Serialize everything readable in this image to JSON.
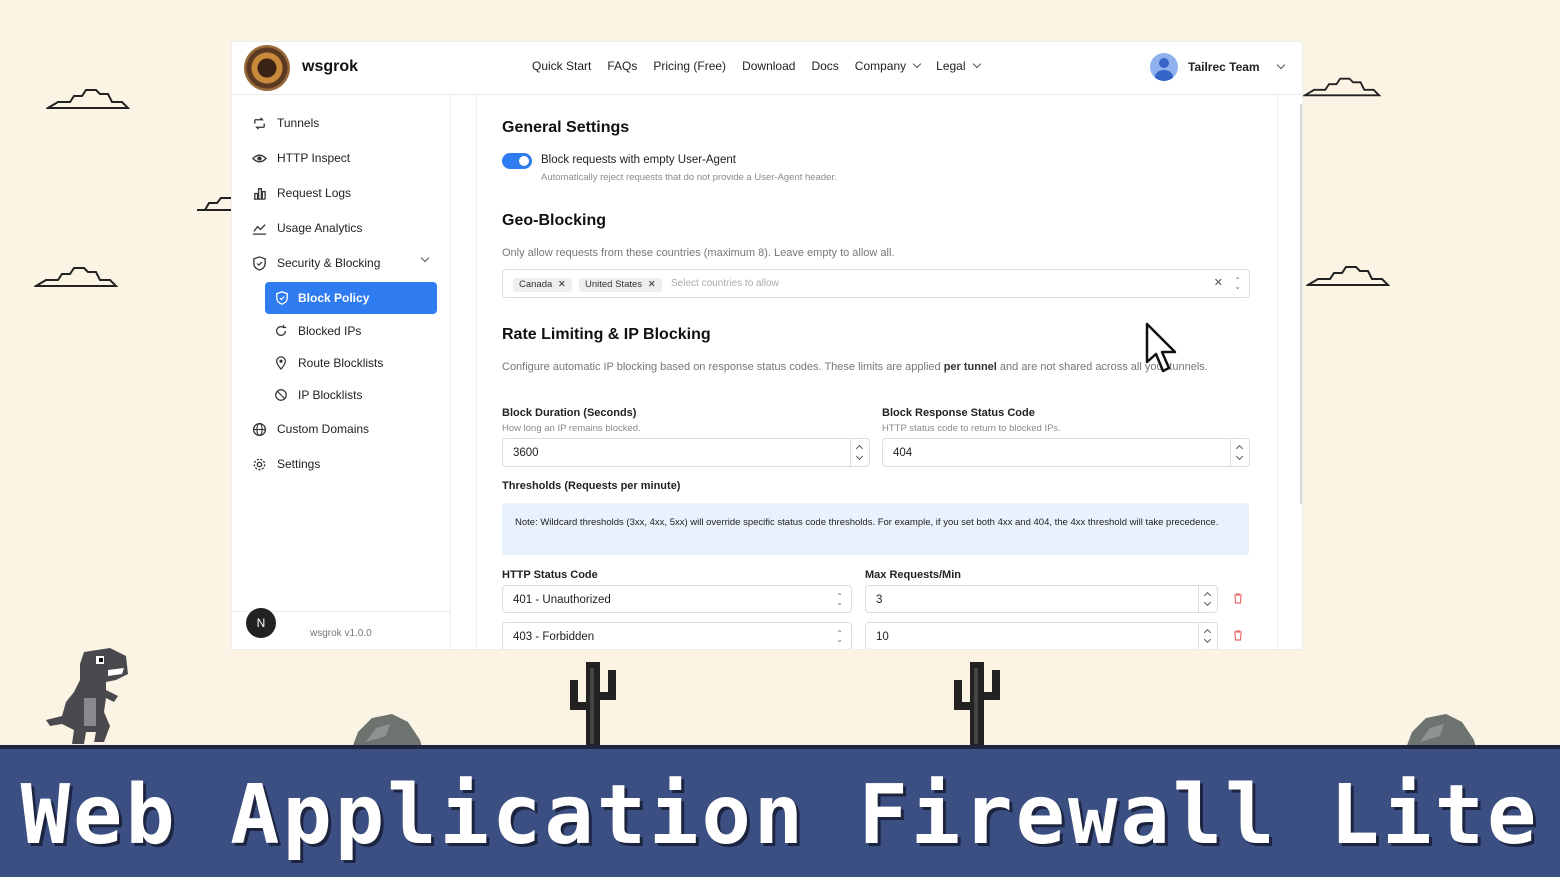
{
  "app": {
    "brand": "wsgrok",
    "nav": [
      {
        "label": "Quick Start"
      },
      {
        "label": "FAQs"
      },
      {
        "label": "Pricing (Free)"
      },
      {
        "label": "Download"
      },
      {
        "label": "Docs"
      },
      {
        "label": "Company",
        "dropdown": true
      },
      {
        "label": "Legal",
        "dropdown": true
      }
    ],
    "user": "Tailrec Team"
  },
  "sidebar": {
    "items": [
      {
        "label": "Tunnels",
        "icon": "tunnels-icon"
      },
      {
        "label": "HTTP Inspect",
        "icon": "eye-icon"
      },
      {
        "label": "Request Logs",
        "icon": "bar-chart-icon"
      },
      {
        "label": "Usage Analytics",
        "icon": "line-chart-icon"
      },
      {
        "label": "Security & Blocking",
        "icon": "shield-icon"
      },
      {
        "label": "Custom Domains",
        "icon": "globe-icon"
      },
      {
        "label": "Settings",
        "icon": "gear-icon"
      }
    ],
    "subitems": [
      {
        "label": "Block Policy",
        "icon": "shield-icon",
        "active": true
      },
      {
        "label": "Blocked IPs",
        "icon": "refresh-icon"
      },
      {
        "label": "Route Blocklists",
        "icon": "location-pin-icon"
      },
      {
        "label": "IP Blocklists",
        "icon": "ban-icon"
      }
    ],
    "footer_badge": "N",
    "version": "wsgrok v1.0.0"
  },
  "general": {
    "title": "General Settings",
    "toggle_label": "Block requests with empty User-Agent",
    "toggle_on": true,
    "toggle_help": "Automatically reject requests that do not provide a User-Agent header."
  },
  "geo": {
    "title": "Geo-Blocking",
    "description": "Only allow requests from these countries (maximum 8). Leave empty to allow all.",
    "chips": [
      "Canada",
      "United States"
    ],
    "placeholder": "Select countries to allow"
  },
  "rate": {
    "title": "Rate Limiting & IP Blocking",
    "description_pre": "Configure automatic IP blocking based on response status codes. These limits are applied ",
    "description_bold": "per tunnel",
    "description_post": " and are not shared across all your tunnels.",
    "block_duration_label": "Block Duration (Seconds)",
    "block_duration_help": "How long an IP remains blocked.",
    "block_duration_value": "3600",
    "block_status_label": "Block Response Status Code",
    "block_status_help": "HTTP status code to return to blocked IPs.",
    "block_status_value": "404",
    "thresholds_label": "Thresholds (Requests per minute)",
    "note": "Note: Wildcard thresholds (3xx, 4xx, 5xx) will override specific status code thresholds. For example, if you set both 4xx and 404, the 4xx threshold will take precedence.",
    "col_status": "HTTP Status Code",
    "col_max": "Max Requests/Min",
    "rows": [
      {
        "status": "401 - Unauthorized",
        "max": "3"
      },
      {
        "status": "403 - Forbidden",
        "max": "10"
      }
    ]
  },
  "banner": "Web Application Firewall Lite",
  "colors": {
    "accent": "#2f7cf0",
    "ground": "#3b4f82",
    "background": "#fbf3e4"
  }
}
